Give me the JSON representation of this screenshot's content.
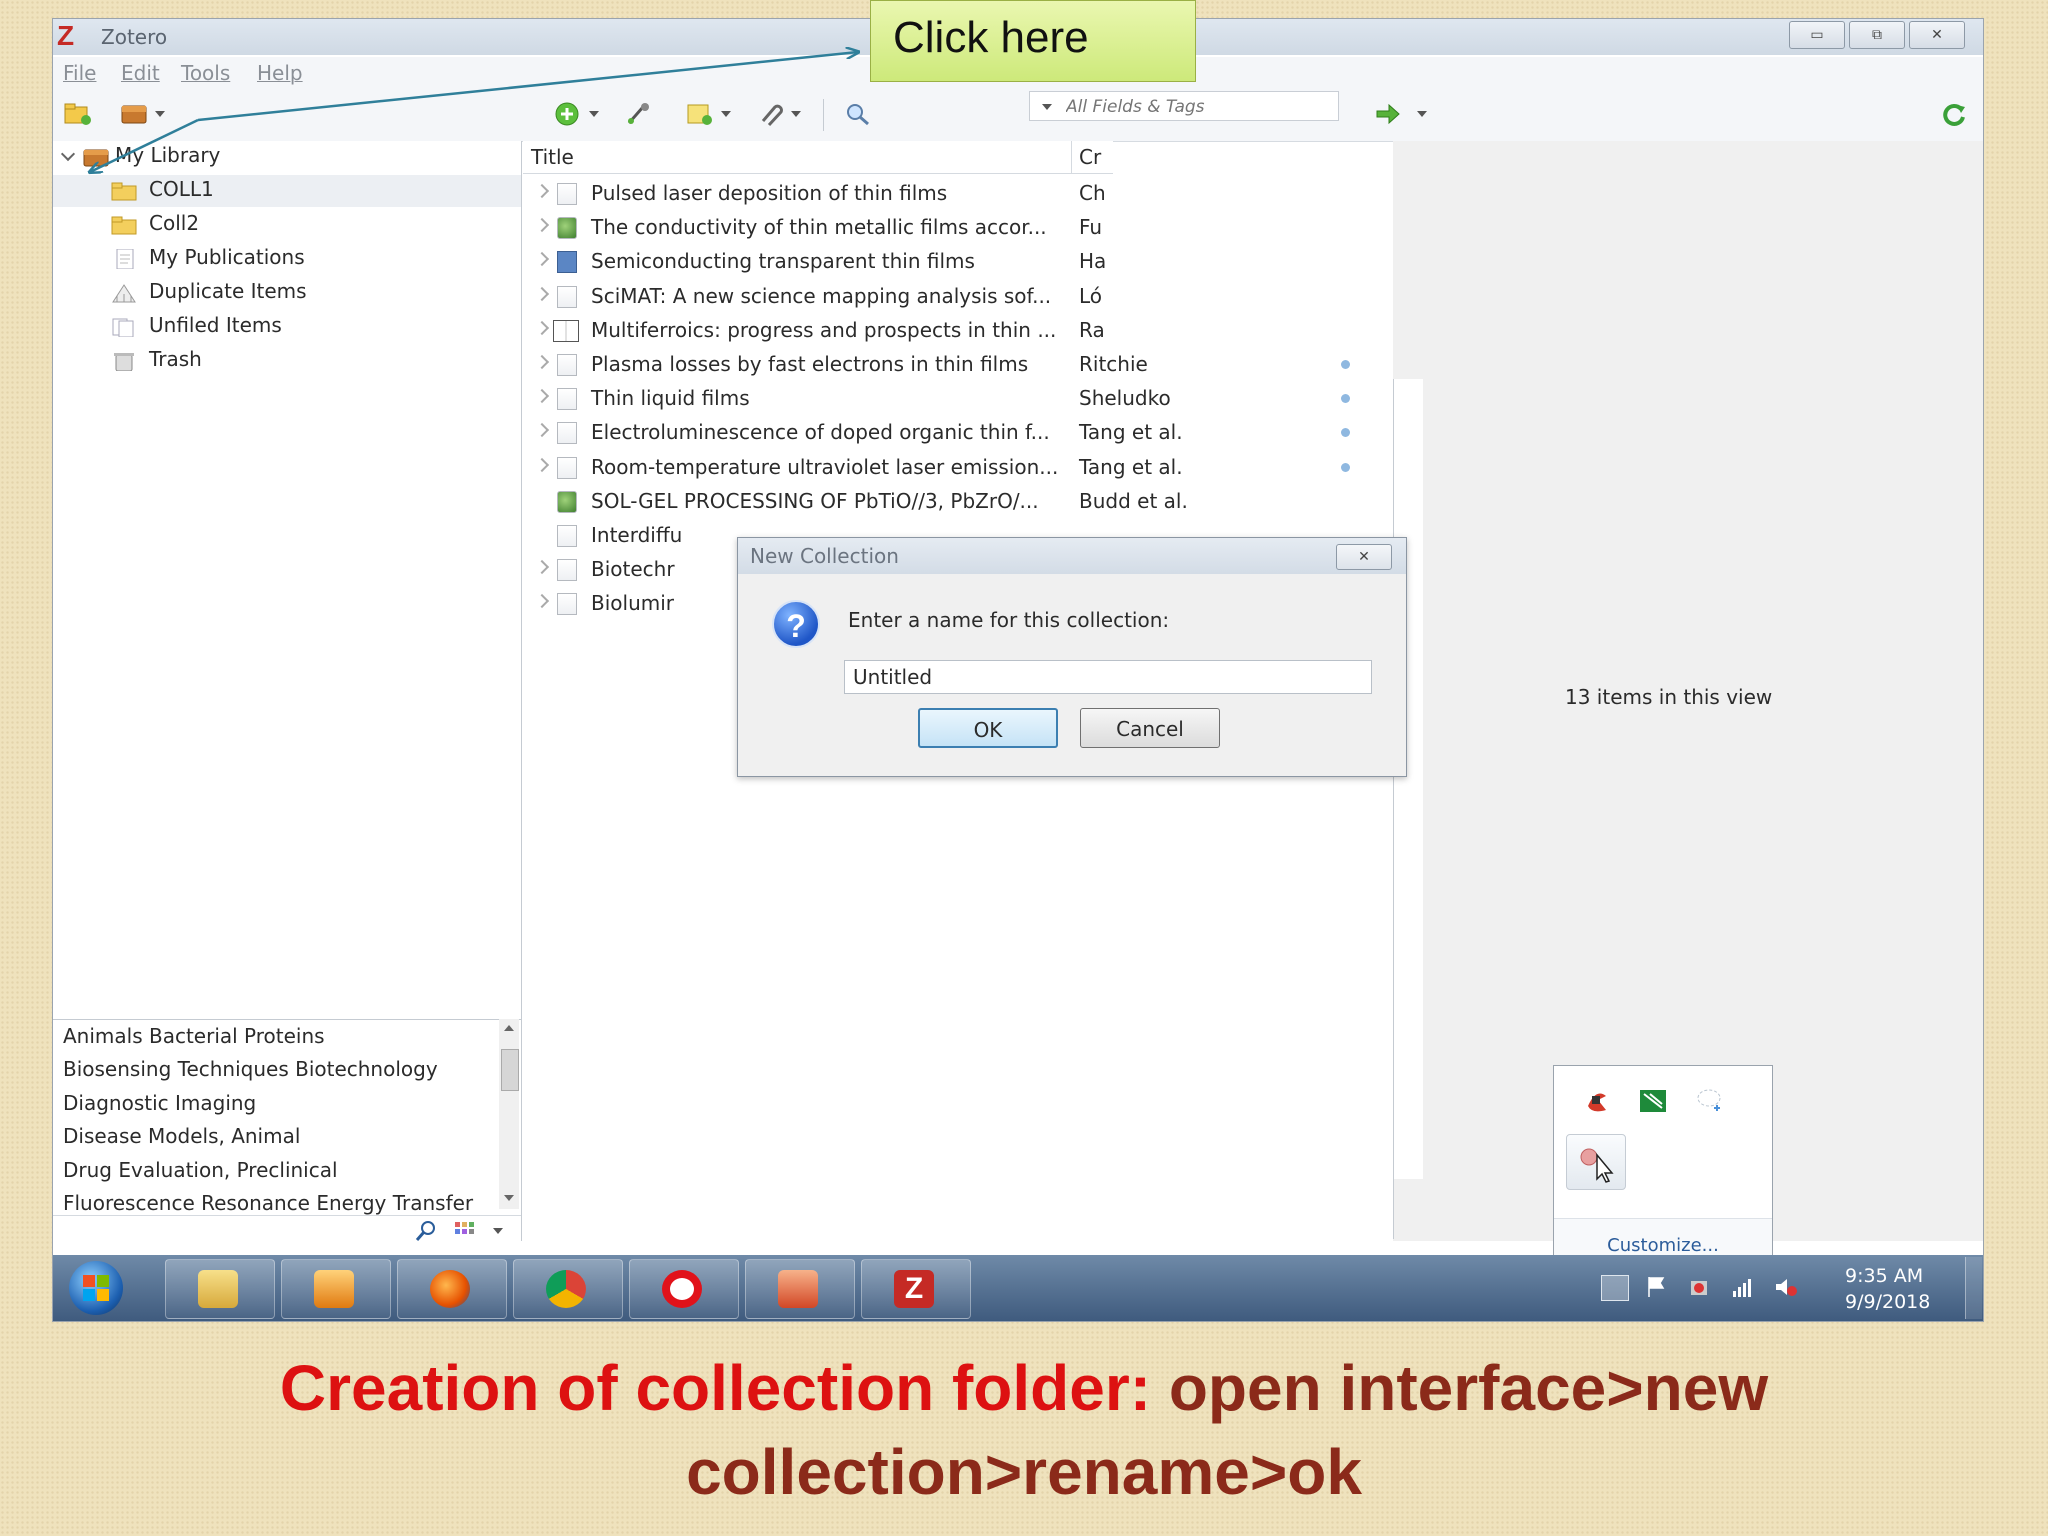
{
  "window": {
    "title": "Zotero",
    "controls": {
      "minimize": "▭",
      "restore": "⧉",
      "close": "✕"
    }
  },
  "menu": [
    "File",
    "Edit",
    "Tools",
    "Help"
  ],
  "toolbar": {
    "search_placeholder": "All Fields & Tags",
    "icons": [
      "new-collection-icon",
      "new-library-icon",
      "new-item-icon",
      "add-by-identifier-icon",
      "new-note-icon",
      "attachment-icon",
      "advanced-search-icon",
      "locate-icon",
      "sync-icon"
    ]
  },
  "collections": {
    "library": "My Library",
    "items": [
      "COLL1",
      "Coll2",
      "My Publications",
      "Duplicate Items",
      "Unfiled Items",
      "Trash"
    ]
  },
  "tags": {
    "lines": [
      "Animals   Bacterial Proteins",
      "Biosensing Techniques   Biotechnology",
      "Diagnostic Imaging",
      "Disease Models, Animal",
      "Drug Evaluation, Preclinical",
      "Fluorescence Resonance Energy Transfer"
    ]
  },
  "items_table": {
    "headers": {
      "title": "Title",
      "creator": "Cr"
    },
    "rows": [
      {
        "title": "Pulsed laser deposition of thin films",
        "creator": "Ch"
      },
      {
        "title": "The conductivity of thin metallic films accor...",
        "creator": "Fu"
      },
      {
        "title": "Semiconducting transparent thin films",
        "creator": "Ha"
      },
      {
        "title": "SciMAT: A new science mapping analysis sof...",
        "creator": "Ló"
      },
      {
        "title": "Multiferroics: progress and prospects in thin ...",
        "creator": "Ra"
      },
      {
        "title": "Plasma losses by fast electrons in thin films",
        "creator": "Ritchie"
      },
      {
        "title": "Thin liquid films",
        "creator": "Sheludko"
      },
      {
        "title": "Electroluminescence of doped organic thin f...",
        "creator": "Tang et al."
      },
      {
        "title": "Room-temperature ultraviolet laser emission...",
        "creator": "Tang et al."
      },
      {
        "title": "SOL-GEL PROCESSING OF PbTiO//3, PbZrO/...",
        "creator": "Budd et al."
      },
      {
        "title": "Interdiffu",
        "creator": ""
      },
      {
        "title": "Biotechr",
        "creator": ""
      },
      {
        "title": "Biolumir",
        "creator": ""
      }
    ]
  },
  "right_pane": {
    "count_text": "13 items in this view"
  },
  "dialog": {
    "title": "New Collection",
    "close": "✕",
    "prompt": "Enter a name for this collection:",
    "value": "Untitled",
    "ok": "OK",
    "cancel": "Cancel"
  },
  "tray_popup": {
    "customize": "Customize..."
  },
  "taskbar": {
    "time": "9:35 AM",
    "date": "9/9/2018"
  },
  "callout": {
    "text": "Click here"
  },
  "caption": {
    "part1": "Creation of collection folder:",
    "part2": " open interface>new",
    "line2": "collection>rename>ok"
  },
  "colors": {
    "caption_red": "#dd1111",
    "caption_brown": "#8b2a1a",
    "callout_green": "#cde97a",
    "arrow": "#2f7f9a"
  }
}
